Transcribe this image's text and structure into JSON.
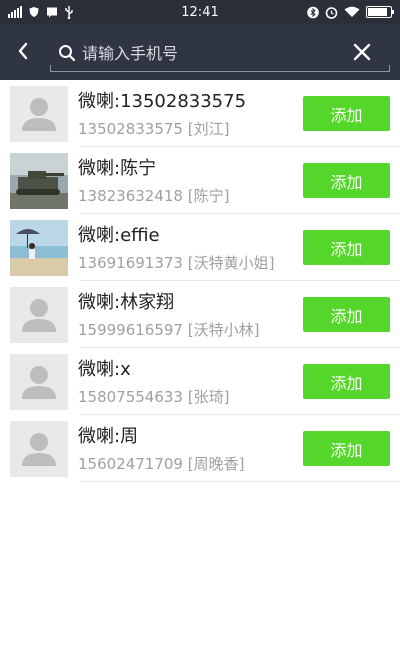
{
  "status_bar": {
    "time": "12:41",
    "battery_level": 0.85,
    "left_icons": [
      "signal-icon",
      "shield-icon",
      "message-icon",
      "usb-icon"
    ],
    "right_icons": [
      "bluetooth-icon",
      "alarm-icon",
      "wifi-icon",
      "battery-icon"
    ]
  },
  "header": {
    "back_icon": "chevron-left-icon",
    "search_placeholder": "请输入手机号",
    "search_value": "",
    "clear_icon": "close-icon"
  },
  "colors": {
    "header_bg": "#303543",
    "status_bg": "#2a2f3a",
    "add_button": "#55d62a",
    "name_text": "#222222",
    "sub_text": "#a0a0a0"
  },
  "contacts": [
    {
      "name": "微喇:13502833575",
      "detail": "13502833575 [刘江]",
      "avatar": "default-avatar-icon",
      "button": "添加"
    },
    {
      "name": "微喇:陈宁",
      "detail": "13823632418 [陈宁]",
      "avatar": "tank-photo",
      "button": "添加"
    },
    {
      "name": "微喇:effie",
      "detail": "13691691373 [沃特黄小姐]",
      "avatar": "beach-photo",
      "button": "添加"
    },
    {
      "name": "微喇:林家翔",
      "detail": "15999616597 [沃特小林]",
      "avatar": "default-avatar-icon",
      "button": "添加"
    },
    {
      "name": "微喇:x",
      "detail": "15807554633 [张琦]",
      "avatar": "default-avatar-icon",
      "button": "添加"
    },
    {
      "name": "微喇:周",
      "detail": "15602471709 [周晚香]",
      "avatar": "default-avatar-icon",
      "button": "添加"
    }
  ]
}
